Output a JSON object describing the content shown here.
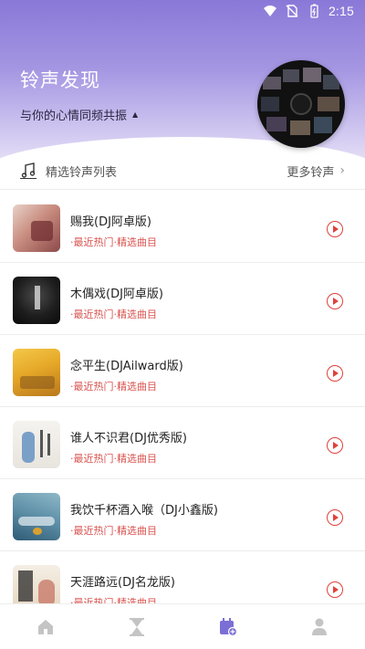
{
  "status_bar": {
    "time": "2:15"
  },
  "header": {
    "title": "铃声发现",
    "subtitle": "与你的心情同频共振"
  },
  "section": {
    "title": "精选铃声列表",
    "more_label": "更多铃声"
  },
  "songs": [
    {
      "title": "赐我(DJ阿卓版)",
      "tags": "·最近热门·精选曲目"
    },
    {
      "title": "木偶戏(DJ阿卓版)",
      "tags": "·最近热门·精选曲目"
    },
    {
      "title": "念平生(DJAilward版)",
      "tags": "·最近热门·精选曲目"
    },
    {
      "title": "谁人不识君(DJ优秀版)",
      "tags": "·最近热门·精选曲目"
    },
    {
      "title": "我饮千杯酒入喉（DJ小鑫版)",
      "tags": "·最近热门·精选曲目"
    },
    {
      "title": "天涯路远(DJ名龙版)",
      "tags": "·最近热门·精选曲目"
    }
  ],
  "bottom_nav": [
    {
      "icon": "home-icon",
      "active": false
    },
    {
      "icon": "hourglass-icon",
      "active": false
    },
    {
      "icon": "calendar-add-icon",
      "active": true
    },
    {
      "icon": "user-icon",
      "active": false
    }
  ],
  "colors": {
    "accent": "#e0413a",
    "nav_active": "#7b6fd6",
    "nav_inactive": "#c4c4c4",
    "header_gradient_top": "#8a78d8"
  }
}
